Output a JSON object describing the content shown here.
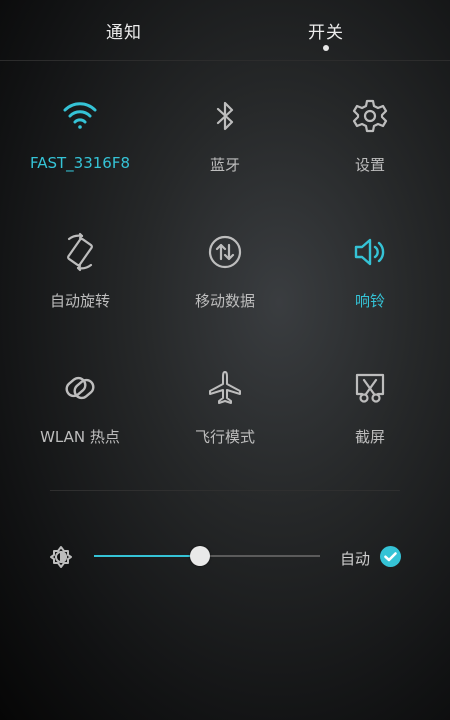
{
  "tabs": {
    "notify": "通知",
    "switches": "开关"
  },
  "tiles": [
    {
      "label": "FAST_3316F8",
      "icon": "wifi-icon",
      "active": true
    },
    {
      "label": "蓝牙",
      "icon": "bluetooth-icon",
      "active": false
    },
    {
      "label": "设置",
      "icon": "gear-icon",
      "active": false
    },
    {
      "label": "自动旋转",
      "icon": "auto-rotate-icon",
      "active": false
    },
    {
      "label": "移动数据",
      "icon": "mobile-data-icon",
      "active": false
    },
    {
      "label": "响铃",
      "icon": "speaker-icon",
      "active": true
    },
    {
      "label": "WLAN 热点",
      "icon": "hotspot-icon",
      "active": false
    },
    {
      "label": "飞行模式",
      "icon": "airplane-icon",
      "active": false
    },
    {
      "label": "截屏",
      "icon": "screenshot-icon",
      "active": false
    }
  ],
  "brightness": {
    "level": 0.47,
    "auto_label": "自动",
    "auto_enabled": true
  },
  "colors": {
    "accent": "#35c3d6",
    "icon_inactive": "#bdbdbd",
    "text": "#bdbdbd"
  }
}
